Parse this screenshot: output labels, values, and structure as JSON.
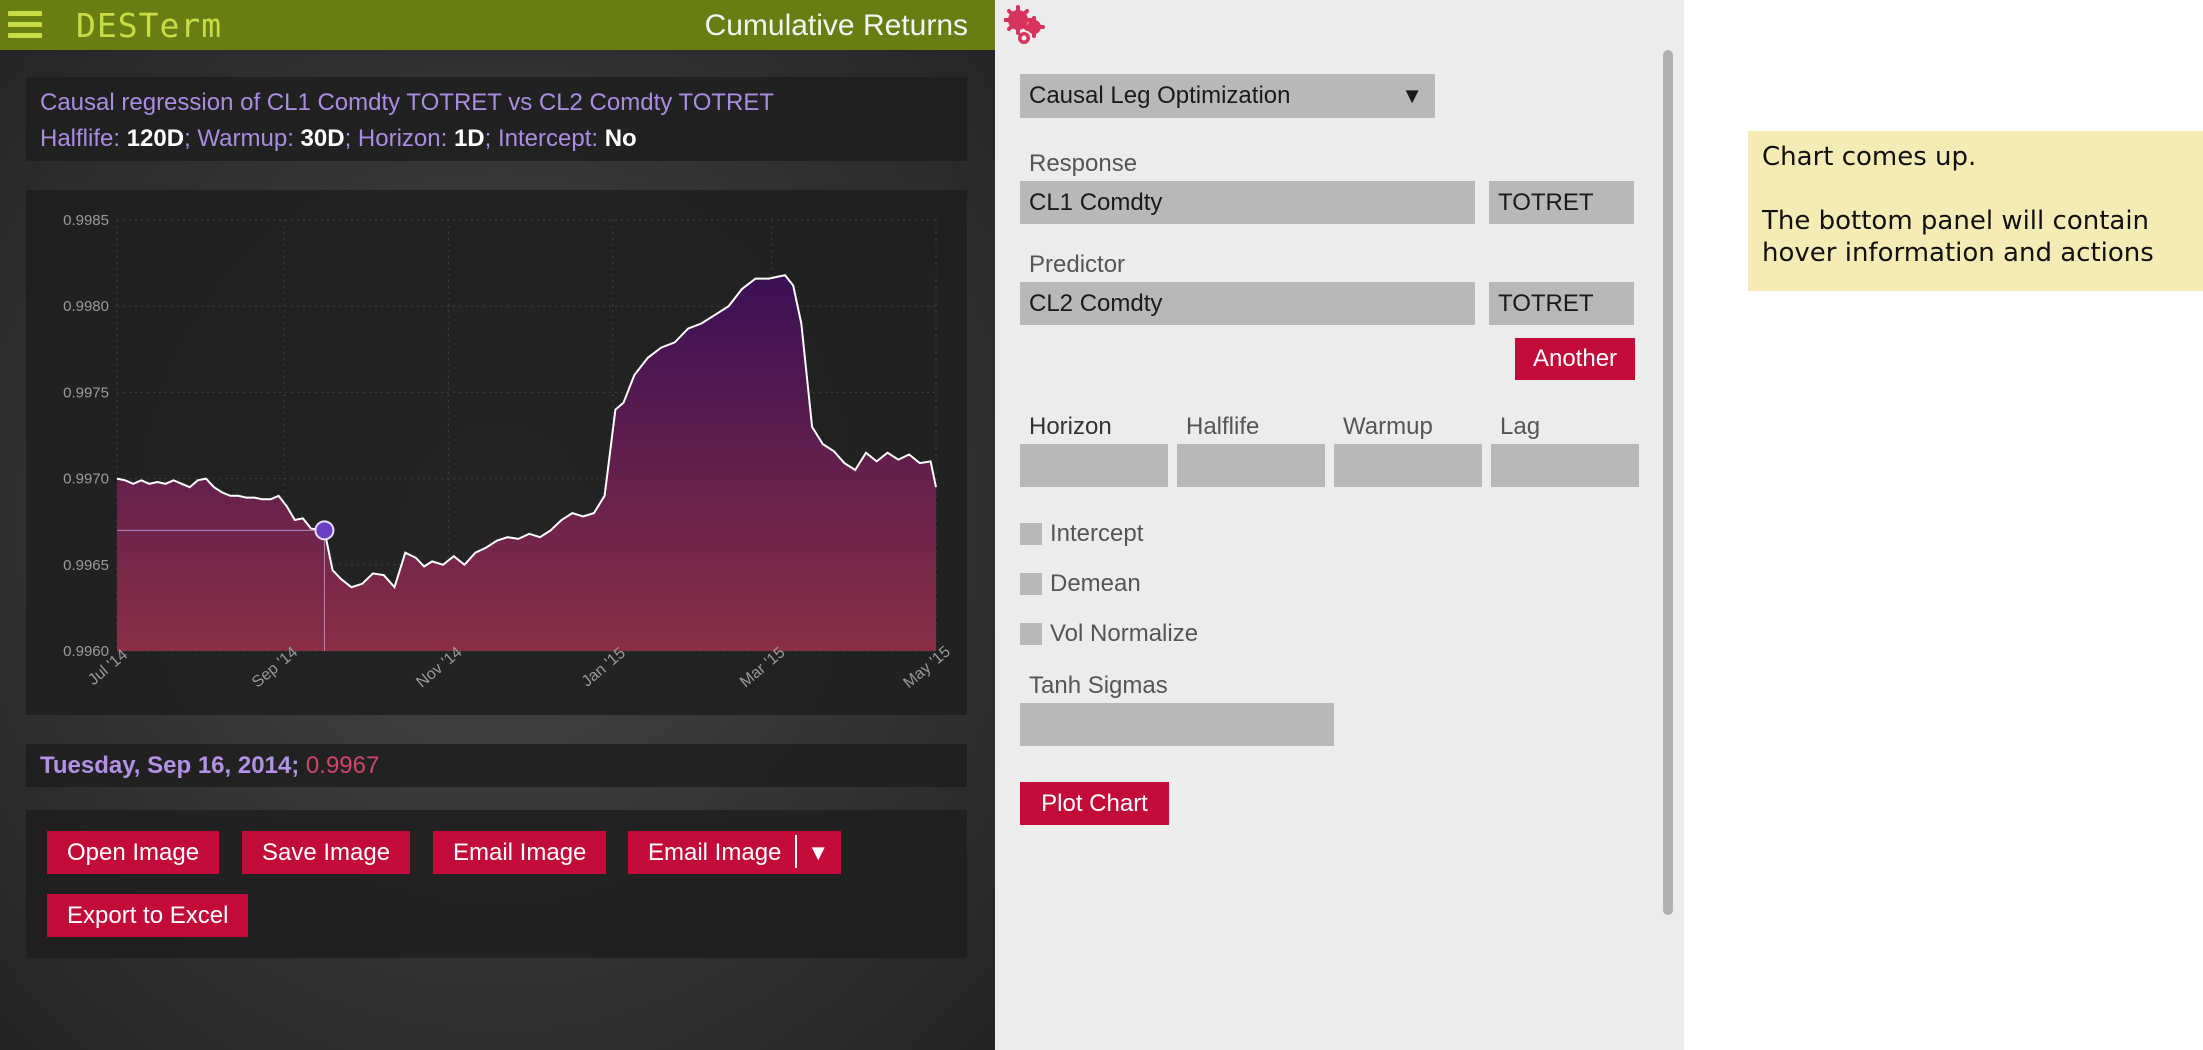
{
  "app": {
    "name": "DESTerm",
    "view_title": "Cumulative Returns"
  },
  "description": {
    "title": "Causal regression of CL1 Comdty TOTRET vs CL2 Comdty TOTRET",
    "halflife_label": "Halflife:",
    "halflife_value": "120D",
    "warmup_label": "; Warmup:",
    "warmup_value": "30D",
    "horizon_label": "; Horizon:",
    "horizon_value": "1D",
    "intercept_label": ";  Intercept:",
    "intercept_value": "No"
  },
  "chart_data": {
    "type": "area",
    "title": "",
    "xlabel": "",
    "ylabel": "",
    "ylim": [
      0.996,
      0.9985
    ],
    "yticks": [
      "0.9985",
      "0.9980",
      "0.9975",
      "0.9970",
      "0.9965",
      "0.9960"
    ],
    "xticks": [
      "Jul '14",
      "Sep '14",
      "Nov '14",
      "Jan '15",
      "Mar '15",
      "May '15"
    ],
    "xtick_dates": [
      "2014-07-01",
      "2014-09-01",
      "2014-11-01",
      "2015-01-01",
      "2015-03-01",
      "2015-05-01"
    ],
    "grid": true,
    "legend": "none",
    "colors": {
      "line": "#ffffff",
      "fill_top": "#3a1055",
      "fill_bottom": "#8a2e45"
    },
    "crosshair": {
      "x": "2014-09-16",
      "y": 0.9967
    },
    "x": [
      "2014-07-01",
      "2014-07-04",
      "2014-07-07",
      "2014-07-10",
      "2014-07-13",
      "2014-07-16",
      "2014-07-19",
      "2014-07-22",
      "2014-07-25",
      "2014-07-28",
      "2014-07-31",
      "2014-08-03",
      "2014-08-06",
      "2014-08-09",
      "2014-08-12",
      "2014-08-15",
      "2014-08-18",
      "2014-08-21",
      "2014-08-24",
      "2014-08-27",
      "2014-08-30",
      "2014-09-02",
      "2014-09-05",
      "2014-09-08",
      "2014-09-11",
      "2014-09-16",
      "2014-09-19",
      "2014-09-22",
      "2014-09-26",
      "2014-09-30",
      "2014-10-04",
      "2014-10-08",
      "2014-10-12",
      "2014-10-16",
      "2014-10-20",
      "2014-10-23",
      "2014-10-26",
      "2014-10-30",
      "2014-11-03",
      "2014-11-07",
      "2014-11-11",
      "2014-11-15",
      "2014-11-19",
      "2014-11-23",
      "2014-11-27",
      "2014-12-01",
      "2014-12-05",
      "2014-12-09",
      "2014-12-13",
      "2014-12-17",
      "2014-12-21",
      "2014-12-25",
      "2014-12-29",
      "2015-01-02",
      "2015-01-05",
      "2015-01-09",
      "2015-01-14",
      "2015-01-19",
      "2015-01-24",
      "2015-01-29",
      "2015-02-03",
      "2015-02-08",
      "2015-02-13",
      "2015-02-18",
      "2015-02-23",
      "2015-02-28",
      "2015-03-03",
      "2015-03-06",
      "2015-03-09",
      "2015-03-12",
      "2015-03-16",
      "2015-03-20",
      "2015-03-24",
      "2015-03-28",
      "2015-04-01",
      "2015-04-05",
      "2015-04-09",
      "2015-04-13",
      "2015-04-17",
      "2015-04-21",
      "2015-04-25",
      "2015-04-29",
      "2015-05-01"
    ],
    "y": [
      0.997,
      0.99699,
      0.99697,
      0.99699,
      0.99697,
      0.99698,
      0.99697,
      0.99699,
      0.99697,
      0.99695,
      0.99699,
      0.997,
      0.99695,
      0.99692,
      0.9969,
      0.9969,
      0.99689,
      0.99689,
      0.99688,
      0.99688,
      0.9969,
      0.99684,
      0.99676,
      0.99677,
      0.99671,
      0.9967,
      0.99647,
      0.99642,
      0.99637,
      0.99639,
      0.99645,
      0.99644,
      0.99637,
      0.99657,
      0.99654,
      0.99649,
      0.99652,
      0.9965,
      0.99655,
      0.9965,
      0.99657,
      0.9966,
      0.99664,
      0.99666,
      0.99665,
      0.99668,
      0.99666,
      0.9967,
      0.99676,
      0.9968,
      0.99678,
      0.9968,
      0.9969,
      0.9974,
      0.99744,
      0.9976,
      0.9977,
      0.99776,
      0.99779,
      0.99787,
      0.9979,
      0.99795,
      0.998,
      0.9981,
      0.99816,
      0.99816,
      0.99817,
      0.99818,
      0.99812,
      0.9979,
      0.9973,
      0.9972,
      0.99716,
      0.99709,
      0.99705,
      0.99715,
      0.9971,
      0.99715,
      0.99711,
      0.99714,
      0.99709,
      0.9971,
      0.99695
    ]
  },
  "hover": {
    "date": "Tuesday, Sep 16, 2014",
    "separator": ";",
    "value": "0.9967"
  },
  "actions": {
    "open_image": "Open Image",
    "save_image": "Save Image",
    "email_image": "Email Image",
    "email_image_menu": "Email Image",
    "export_excel": "Export to Excel"
  },
  "settings": {
    "mode_select": "Causal Leg Optimization",
    "response_label": "Response",
    "response_security": "CL1 Comdty",
    "response_field": "TOTRET",
    "predictor_label": "Predictor",
    "predictor_security": "CL2 Comdty",
    "predictor_field": "TOTRET",
    "another_label": "Another",
    "horizon_label": "Horizon",
    "halflife_label": "Halflife",
    "warmup_label": "Warmup",
    "lag_label": "Lag",
    "horizon_value": "",
    "halflife_value": "",
    "warmup_value": "",
    "lag_value": "",
    "intercept_label": "Intercept",
    "demean_label": "Demean",
    "vol_normalize_label": "Vol Normalize",
    "tanh_sigmas_label": "Tanh Sigmas",
    "tanh_sigmas_value": "",
    "plot_chart_label": "Plot Chart"
  },
  "note": {
    "line1": "Chart comes up.",
    "line2a": "The bottom panel will contain",
    "line2b": "hover information and actions"
  },
  "colors": {
    "topbar": "#687d12",
    "brand_text": "#c7dd45",
    "accent_red": "#c30b3a",
    "purple_text": "#a98de2",
    "note_bg": "#f5ecb5"
  }
}
